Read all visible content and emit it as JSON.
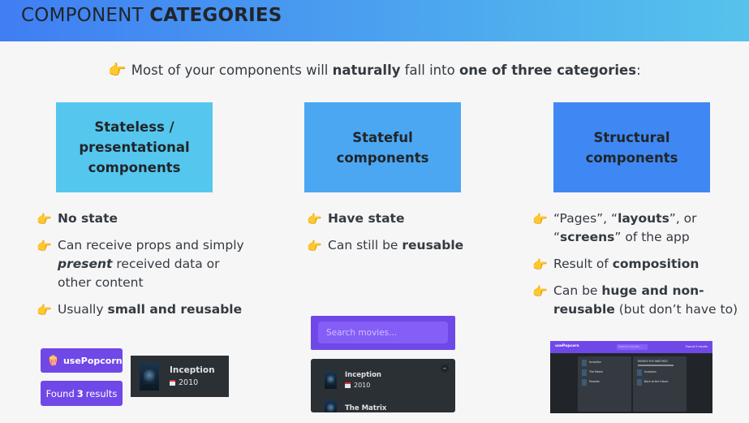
{
  "header": {
    "title_regular": "COMPONENT",
    "title_bold": "CATEGORIES"
  },
  "intro": {
    "part1": "Most of your components will",
    "bold1": "naturally",
    "part2": "fall into",
    "bold2": "one of three categories",
    "end": ":"
  },
  "categories": [
    {
      "title": "Stateless / presentational components",
      "points": [
        {
          "bold": "No state"
        },
        {
          "text1": "Can receive props and simply",
          "italic": "present",
          "text2": "received data or other content"
        },
        {
          "text1": "Usually",
          "bold": "small and reusable"
        }
      ]
    },
    {
      "title": "Stateful components",
      "points": [
        {
          "bold": "Have state"
        },
        {
          "text1": "Can still be",
          "bold": "reusable"
        }
      ]
    },
    {
      "title": "Structural components",
      "points": [
        {
          "q1": "“Pages”, “",
          "b1": "layouts",
          "q2": "”, or “",
          "b2": "screens",
          "q3": "” of the app"
        },
        {
          "text1": "Result of",
          "bold": "composition"
        },
        {
          "text1": "Can be",
          "bold": "huge and non-reusable",
          "text2": "(but don’t have to)"
        }
      ]
    }
  ],
  "samples": {
    "logo": "usePopcorn",
    "found_prefix": "Found",
    "found_count": "3",
    "found_suffix": "results",
    "movie_card": {
      "title": "Inception",
      "year": "2010"
    },
    "search_placeholder": "Search movies...",
    "list": [
      {
        "title": "Inception",
        "year": "2010"
      },
      {
        "title": "The Matrix",
        "year": ""
      }
    ],
    "toggle": "–",
    "mini_app": {
      "logo": "usePopcorn",
      "search": "Search movies...",
      "found": "Found 3 results",
      "items": [
        "Inception",
        "The Matrix",
        "Parasite"
      ],
      "watched_heading": "MOVIES YOU WATCHED",
      "watched_items": [
        "Inception",
        "Back to the Future"
      ]
    }
  },
  "icons": {
    "pointer": "backhand-index-pointing-right-icon",
    "popcorn": "popcorn-icon",
    "calendar": "calendar-icon"
  },
  "colors": {
    "header_start": "#3f7ef3",
    "header_end": "#56c3ec",
    "box1": "#55c7ef",
    "box2": "#4ba7f2",
    "box3": "#3f88f4",
    "app_purple": "#7048e8",
    "app_dark": "#2b3035"
  }
}
